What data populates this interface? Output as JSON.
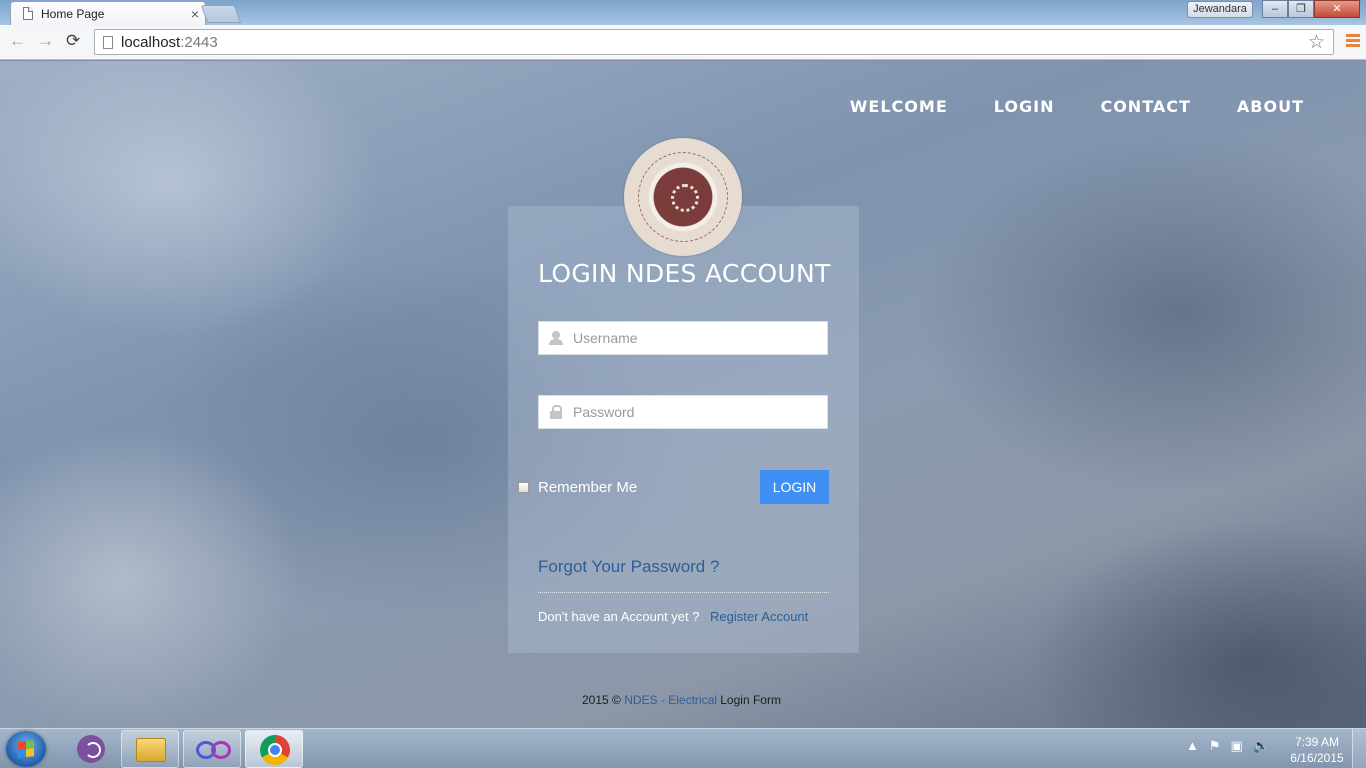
{
  "browser": {
    "tab_title": "Home Page",
    "tab_close": "×",
    "user": "Jewandara",
    "window_buttons": {
      "minimize": "–",
      "restore": "❐",
      "close": "✕"
    },
    "nav": {
      "back": "←",
      "forward": "→",
      "reload": "⟳"
    },
    "url_host": "localhost",
    "url_port": ":2443",
    "star": "☆"
  },
  "site_nav": {
    "items": [
      "WELCOME",
      "LOGIN",
      "CONTACT",
      "ABOUT"
    ]
  },
  "login": {
    "title": "LOGIN NDES ACCOUNT",
    "username_placeholder": "Username",
    "password_placeholder": "Password",
    "remember_label": "Remember Me",
    "login_button": "LOGIN",
    "forgot_link": "Forgot Your Password ?",
    "no_account_text": "Don't have an Account yet ?",
    "register_link": "Register Account"
  },
  "footer": {
    "prefix": "2015 ©",
    "link": "NDES - Electrical",
    "suffix": "Login Form"
  },
  "taskbar": {
    "tray_up": "▲",
    "time": "7:39 AM",
    "date": "6/16/2015"
  },
  "colors": {
    "accent_button": "#3f8ff5",
    "link": "#2e5e97",
    "menu_icon": "#e8833a"
  }
}
